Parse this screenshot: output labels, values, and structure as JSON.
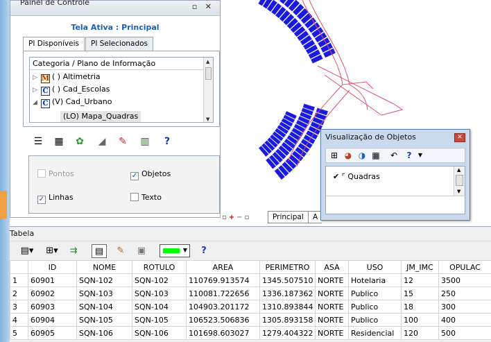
{
  "control_panel": {
    "title": "Painel de Controle",
    "window_buttons": "▫ ✕",
    "active_label": "Tela Ativa : Principal",
    "tabs": [
      {
        "label": "PI Disponíveis"
      },
      {
        "label": "PI Selecionados"
      }
    ],
    "tree": {
      "header": "Categoria / Plano de Informação",
      "items": [
        {
          "expander": "▷",
          "icon": "M",
          "label": "( ) Altimetria"
        },
        {
          "expander": "▷",
          "icon": "C",
          "label": "( ) Cad_Escolas"
        },
        {
          "expander": "◢",
          "icon": "C",
          "label": "(V) Cad_Urbano"
        }
      ],
      "selected_child": "(LO) Mapa_Quadras"
    },
    "options": {
      "pontos": {
        "label": "Pontos",
        "checked": false
      },
      "objetos": {
        "label": "Objetos",
        "checked": true
      },
      "linhas": {
        "label": "Linhas",
        "checked": true
      },
      "texto": {
        "label": "Texto",
        "checked": false
      }
    }
  },
  "map": {
    "view_tabs": [
      {
        "label": "Principal"
      },
      {
        "label": "A"
      }
    ],
    "colors": {
      "blocks": "#1a1adc",
      "roads": "#e05070"
    }
  },
  "object_window": {
    "title": "Visualização de Objetos",
    "close_glyph": "✕",
    "items": [
      {
        "check": "✔",
        "label": "Quadras"
      }
    ]
  },
  "table": {
    "label": "Tabela",
    "columns": [
      "",
      "ID",
      "NOME",
      "ROTULO",
      "AREA",
      "PERIMETRO",
      "ASA",
      "USO",
      "JM_IMC",
      "OPULAC"
    ],
    "rows": [
      [
        "1",
        "60901",
        "SQN-102",
        "SQN-102",
        "110769.913574",
        "1345.507510",
        "NORTE",
        "Hotelaria",
        "12",
        "3500"
      ],
      [
        "2",
        "60902",
        "SQN-103",
        "SQN-103",
        "110081.722656",
        "1336.187362",
        "NORTE",
        "Publico",
        "15",
        "250"
      ],
      [
        "3",
        "60903",
        "SQN-104",
        "SQN-104",
        "104903.201172",
        "1310.893844",
        "NORTE",
        "Publico",
        "18",
        "300"
      ],
      [
        "4",
        "60904",
        "SQN-105",
        "SQN-105",
        "106523.506836",
        "1305.893158",
        "NORTE",
        "Publico",
        "100",
        "400"
      ],
      [
        "5",
        "60905",
        "SQN-106",
        "SQN-106",
        "101698.603027",
        "1279.404322",
        "NORTE",
        "Residencial",
        "120",
        "500"
      ]
    ],
    "line_color": "#00ff00"
  }
}
